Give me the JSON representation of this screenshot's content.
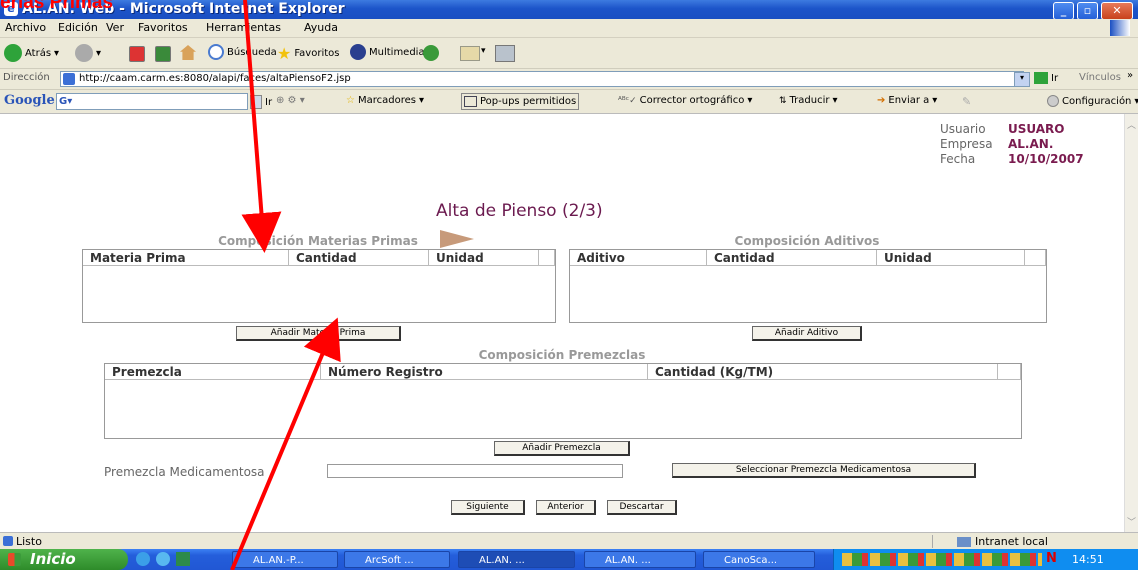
{
  "annotation": {
    "top_text": "erias Primas"
  },
  "window": {
    "title": "AL.AN. Web - Microsoft Internet Explorer",
    "minimize": "_",
    "maximize": "▫",
    "close": "✕"
  },
  "menu": [
    "Archivo",
    "Edición",
    "Ver",
    "Favoritos",
    "Herramientas",
    "Ayuda"
  ],
  "toolbar": {
    "back": "Atrás",
    "search": "Búsqueda",
    "favorites": "Favoritos",
    "multimedia": "Multimedia"
  },
  "address": {
    "label": "Dirección",
    "url": "http://caam.carm.es:8080/alapi/faces/altaPiensoF2.jsp",
    "go": "Ir",
    "links": "Vínculos"
  },
  "googlebar": {
    "logo": "Google",
    "go": "Ir",
    "bookmarks": "Marcadores",
    "popups": "Pop-ups permitidos",
    "spell": "Corrector ortográfico",
    "translate": "Traducir",
    "send": "Enviar a",
    "settings": "Configuración"
  },
  "user": {
    "usuario_label": "Usuario",
    "usuario": "USUARO",
    "empresa_label": "Empresa",
    "empresa": "AL.AN.",
    "fecha_label": "Fecha",
    "fecha": "10/10/2007"
  },
  "page_title": "Alta de Pienso (2/3)",
  "materias": {
    "title": "Composición Materias Primas",
    "columns": [
      "Materia Prima",
      "Cantidad",
      "Unidad"
    ],
    "add_button": "Añadir Materia Prima"
  },
  "aditivos": {
    "title": "Composición Aditivos",
    "columns": [
      "Aditivo",
      "Cantidad",
      "Unidad"
    ],
    "add_button": "Añadir Aditivo"
  },
  "premezclas": {
    "title": "Composición Premezclas",
    "columns": [
      "Premezcla",
      "Número Registro",
      "Cantidad (Kg/TM)"
    ],
    "add_button": "Añadir Premezcla"
  },
  "medicamentosa": {
    "label": "Premezcla Medicamentosa",
    "value": "",
    "select_button": "Seleccionar Premezcla Medicamentosa"
  },
  "nav": {
    "next": "Siguiente",
    "prev": "Anterior",
    "discard": "Descartar"
  },
  "status": {
    "text": "Listo",
    "zone": "Intranet local"
  },
  "taskbar": {
    "start": "Inicio",
    "tasks": [
      "AL.AN.-P...",
      "ArcSoft ...",
      "AL.AN. ...",
      "AL.AN. ...",
      "CanoSca..."
    ],
    "clock": "14:51"
  }
}
